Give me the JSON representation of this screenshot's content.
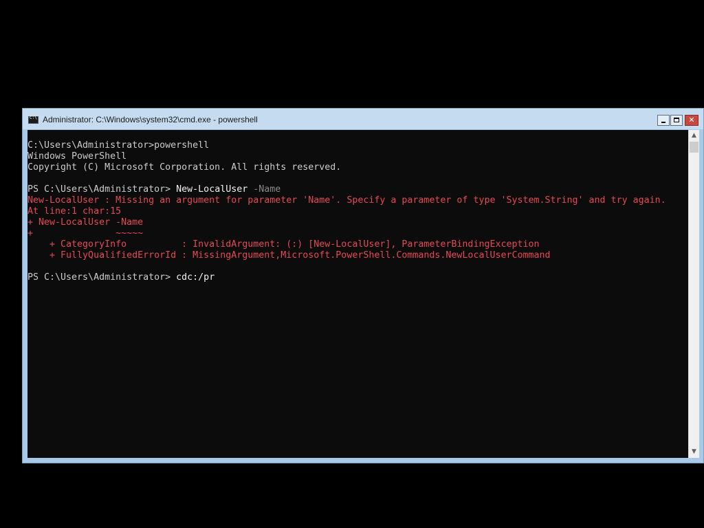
{
  "window": {
    "title": "Administrator: C:\\Windows\\system32\\cmd.exe - powershell",
    "icon": "cmd-icon",
    "controls": {
      "minimize": "minimize-icon",
      "maximize": "maximize-icon",
      "close": "close-icon",
      "close_glyph": "✕"
    }
  },
  "console": {
    "lines": [
      {
        "kind": "plain",
        "text": "C:\\Users\\Administrator>powershell"
      },
      {
        "kind": "plain",
        "text": "Windows PowerShell"
      },
      {
        "kind": "plain",
        "text": "Copyright (C) Microsoft Corporation. All rights reserved."
      },
      {
        "kind": "blank",
        "text": ""
      },
      {
        "kind": "prompt",
        "prompt": "PS C:\\Users\\Administrator> ",
        "command": "New-LocalUser",
        "argument": " -Name"
      },
      {
        "kind": "error",
        "text": "New-LocalUser : Missing an argument for parameter 'Name'. Specify a parameter of type 'System.String' and try again."
      },
      {
        "kind": "error",
        "text": "At line:1 char:15"
      },
      {
        "kind": "error",
        "text": "+ New-LocalUser -Name"
      },
      {
        "kind": "error",
        "text": "+               ~~~~~"
      },
      {
        "kind": "error",
        "text": "    + CategoryInfo          : InvalidArgument: (:) [New-LocalUser], ParameterBindingException"
      },
      {
        "kind": "error",
        "text": "    + FullyQualifiedErrorId : MissingArgument,Microsoft.PowerShell.Commands.NewLocalUserCommand"
      },
      {
        "kind": "blank",
        "text": ""
      },
      {
        "kind": "prompt",
        "prompt": "PS C:\\Users\\Administrator> ",
        "command": "cdc:/pr",
        "argument": ""
      }
    ]
  },
  "scrollbar": {
    "up_glyph": "▲",
    "down_glyph": "▼"
  },
  "colors": {
    "console_bg": "#0c0c0c",
    "console_text": "#cccccc",
    "error_text": "#e74856",
    "titlebar": "#c5dcf0",
    "close_button": "#c7483d"
  }
}
